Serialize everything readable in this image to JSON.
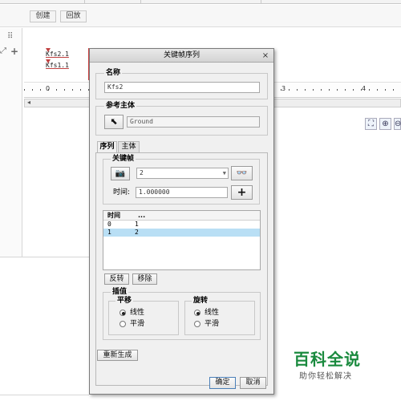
{
  "background": {
    "toolbar": {
      "create_label": "创建",
      "playback_label": "回放"
    },
    "tree": {
      "item1": "Kfs2.1",
      "item2": "Kfs1.1"
    },
    "ruler": {
      "ticks": [
        "0",
        "3",
        "4"
      ]
    }
  },
  "dialog": {
    "title": "关键帧序列",
    "close_glyph": "×",
    "name": {
      "label": "名称",
      "value": "Kfs2"
    },
    "reference": {
      "label": "参考主体",
      "value": "Ground"
    },
    "tabs": {
      "sequence": "序列",
      "main_body": "主体"
    },
    "keyframe": {
      "label": "关键帧",
      "selected": "2",
      "time_label": "时间:",
      "time_value": "1.000000",
      "add_glyph": "+"
    },
    "table": {
      "col_time": "时间",
      "col_dots": "...",
      "rows": [
        {
          "time": "0",
          "frame": "1"
        },
        {
          "time": "1",
          "frame": "2"
        }
      ]
    },
    "reverse_label": "反转",
    "remove_label": "移除",
    "interpolation": {
      "label": "插值",
      "translation": {
        "label": "平移",
        "linear": "线性",
        "smooth": "平滑"
      },
      "rotation": {
        "label": "旋转",
        "linear": "线性",
        "smooth": "平滑"
      }
    },
    "regenerate_label": "重新生成",
    "ok_label": "确定",
    "cancel_label": "取消"
  },
  "watermark": {
    "title": "百科全说",
    "subtitle": "助你轻松解决"
  },
  "colors": {
    "selection": "#b9dff5",
    "watermark_green": "#1a8a3e",
    "tree_marker": "#c04040"
  }
}
